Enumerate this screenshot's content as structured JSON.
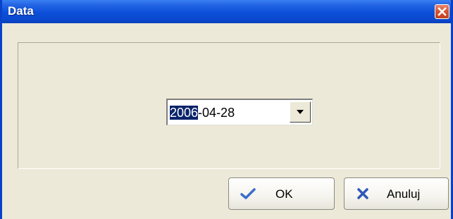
{
  "window": {
    "title": "Data",
    "close_icon": "close-icon"
  },
  "date_picker": {
    "value_selected": "2006",
    "value_rest": "-04-28",
    "dropdown_icon": "chevron-down-icon"
  },
  "buttons": {
    "ok_label": "OK",
    "ok_icon": "checkmark-icon",
    "cancel_label": "Anuluj",
    "cancel_icon": "x-icon"
  },
  "colors": {
    "titlebar": "#0A48CE",
    "selection": "#0A246A",
    "dialog_bg": "#ECE9D8",
    "close_button": "#D8512F"
  }
}
